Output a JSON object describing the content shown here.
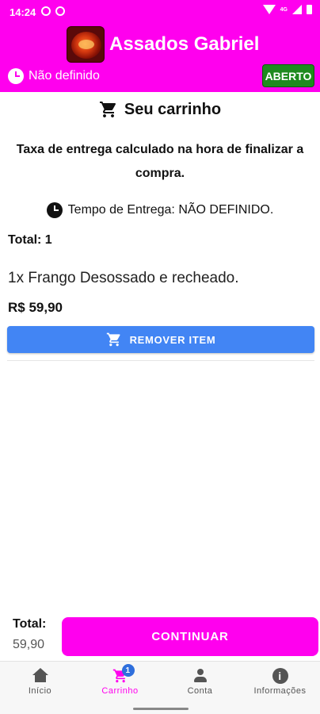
{
  "status_bar": {
    "time": "14:24",
    "network": "4G"
  },
  "header": {
    "store_name": "Assados Gabriel",
    "time_label": "Não definido",
    "status_badge": "ABERTO",
    "colors": {
      "brand": "#ff00ee",
      "open": "#1f8a1f"
    }
  },
  "cart": {
    "title": "Seu carrinho",
    "delivery_note": "Taxa de entrega calculado na hora de finalizar a compra.",
    "delivery_time": "Tempo de Entrega: NÃO DEFINIDO.",
    "total_count": "Total: 1",
    "items": [
      {
        "name": "1x Frango Desossado e recheado.",
        "price": "R$ 59,90",
        "remove_label": "REMOVER ITEM"
      }
    ]
  },
  "footer": {
    "total_label": "Total:",
    "total_value": "59,90",
    "continue_label": "CONTINUAR"
  },
  "nav": {
    "items": [
      {
        "label": "Início",
        "icon": "home-icon"
      },
      {
        "label": "Carrinho",
        "icon": "cart-icon",
        "badge": "1",
        "active": true
      },
      {
        "label": "Conta",
        "icon": "account-icon"
      },
      {
        "label": "Informações",
        "icon": "info-icon"
      }
    ],
    "info_glyph": "i"
  },
  "colors": {
    "accent": "#4285f4",
    "brand": "#ff00ee"
  }
}
